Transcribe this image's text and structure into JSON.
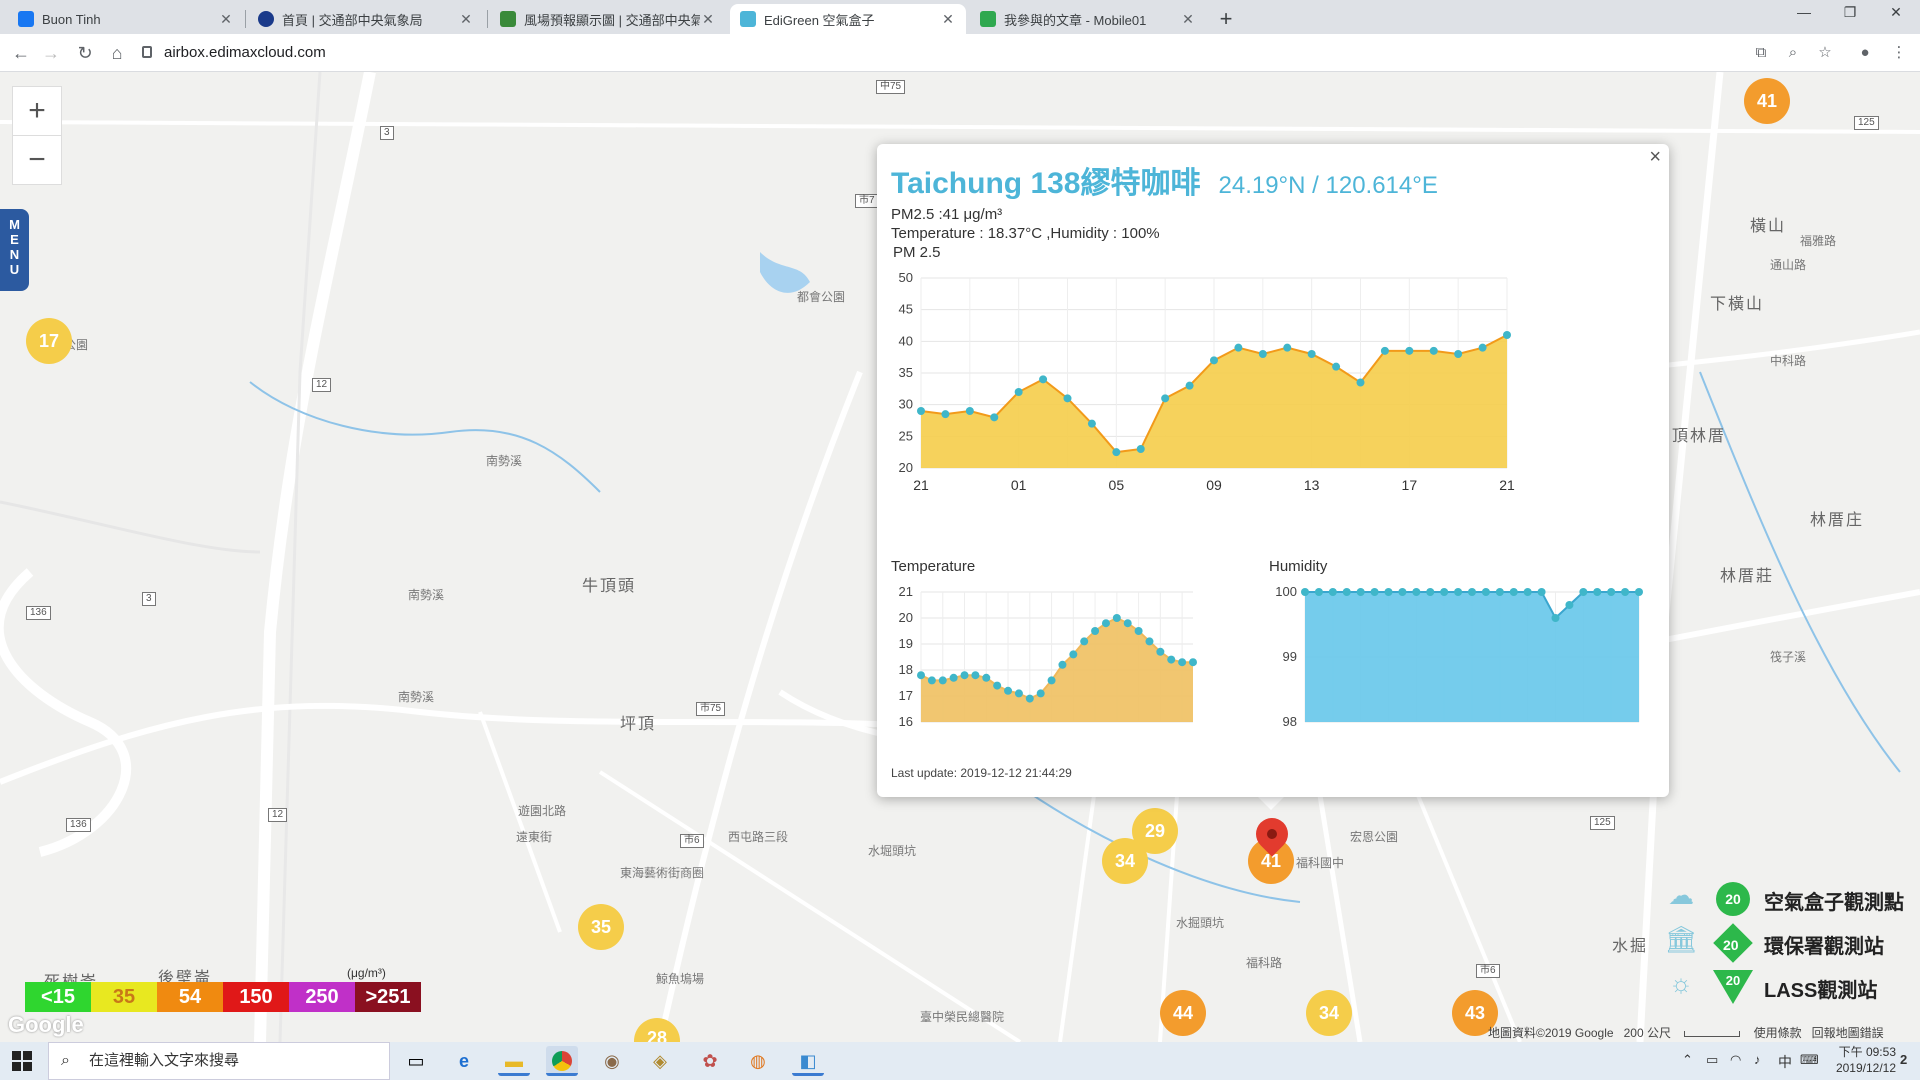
{
  "browser": {
    "tabs": [
      {
        "title": "Buon Tinh",
        "color": "#1877f2"
      },
      {
        "title": "首頁 | 交通部中央氣象局",
        "color": "#1a3a8a"
      },
      {
        "title": "風場預報顯示圖 | 交通部中央氣象局",
        "color": "#3a8a3a"
      },
      {
        "title": "EdiGreen 空氣盒子",
        "color": "#4db5d8"
      },
      {
        "title": "我參與的文章 - Mobile01",
        "color": "#2fa84f"
      }
    ],
    "url": "airbox.edimaxcloud.com",
    "new_tab": "+",
    "win_min": "—",
    "win_max": "❐",
    "win_close": "✕"
  },
  "map": {
    "zoom_in": "+",
    "zoom_out": "−",
    "menu_label": "MENU",
    "markers": [
      {
        "value": "41",
        "level": "o"
      },
      {
        "value": "17",
        "level": "y"
      },
      {
        "value": "29",
        "level": "y"
      },
      {
        "value": "34",
        "level": "y"
      },
      {
        "value": "41",
        "level": "o"
      },
      {
        "value": "35",
        "level": "y"
      },
      {
        "value": "44",
        "level": "o"
      },
      {
        "value": "34",
        "level": "y"
      },
      {
        "value": "43",
        "level": "o"
      },
      {
        "value": "28",
        "level": "y"
      }
    ],
    "place_labels": [
      "牛頂頭",
      "坪頂",
      "都會公園",
      "明秀公園",
      "橫山",
      "下橫山",
      "頂林厝",
      "林厝庄",
      "林厝莊",
      "東海藝術街商圈",
      "宏恩公園",
      "後壁崙",
      "死樹崙",
      "福科國中",
      "水掘",
      "鯨魚塢場",
      "臺中榮民總醫院"
    ],
    "water_labels": [
      "南勢溪",
      "南勢溪",
      "南勢溪",
      "水掘頭坑",
      "水堀頭坑",
      "筏子溪"
    ],
    "road_labels": [
      "福科路",
      "西屯路三段",
      "遊園北路",
      "遠東街",
      "中科路",
      "通山路",
      "福雅路"
    ],
    "road_shields": [
      "中75",
      "市75",
      "市6",
      "市6",
      "市7",
      "125",
      "125",
      "136",
      "136",
      "12",
      "12",
      "3",
      "3"
    ],
    "legend": {
      "unit": "(μg/m³)",
      "levels": [
        {
          "label": "<15",
          "color": "#2fd62f"
        },
        {
          "label": "35",
          "color": "#e8e820"
        },
        {
          "label": "54",
          "color": "#f08a10"
        },
        {
          "label": "150",
          "color": "#e01818"
        },
        {
          "label": "250",
          "color": "#c030c8"
        },
        {
          "label": ">251",
          "color": "#8a1020"
        }
      ]
    },
    "type_legend": [
      {
        "badge": "20",
        "label": "空氣盒子觀測點",
        "shape": "circle",
        "icon": "cloud-box-icon"
      },
      {
        "badge": "20",
        "label": "環保署觀測站",
        "shape": "diamond",
        "icon": "government-building-icon"
      },
      {
        "badge": "20",
        "label": "LASS觀測站",
        "shape": "tri",
        "icon": "sun-wave-icon"
      }
    ],
    "google_logo": "Google",
    "attribution": "地圖資料©2019 Google",
    "scale": "200 公尺",
    "terms": "使用條款",
    "report": "回報地圖錯誤"
  },
  "popup": {
    "close": "×",
    "title": "Taichung 138繆特咖啡",
    "coords": "24.19°N / 120.614°E",
    "pm25_line": "PM2.5 :41 μg/m³",
    "temp_hum_line": "Temperature : 18.37°C ,Humidity : 100%",
    "chart_title": "PM 2.5",
    "last_update": "Last update: 2019-12-12 21:44:29"
  },
  "chart_data": [
    {
      "type": "area",
      "title": "PM 2.5",
      "x": [
        "21",
        "22",
        "23",
        "00",
        "01",
        "02",
        "03",
        "04",
        "05",
        "06",
        "07",
        "08",
        "09",
        "10",
        "11",
        "12",
        "13",
        "14",
        "15",
        "16",
        "17",
        "18",
        "19",
        "20",
        "21"
      ],
      "x_tick_labels": [
        "21",
        "01",
        "05",
        "09",
        "13",
        "17",
        "21"
      ],
      "values": [
        29,
        28.5,
        29,
        28,
        32,
        34,
        31,
        27,
        22.5,
        23,
        31,
        33,
        37,
        39,
        38,
        39,
        38,
        36,
        33.5,
        38.5,
        38.5,
        38.5,
        38,
        39,
        41
      ],
      "ylim": [
        20,
        50
      ],
      "y_ticks": [
        20,
        25,
        30,
        35,
        40,
        45,
        50
      ],
      "grid": true,
      "color": "#f5cd4a"
    },
    {
      "type": "area",
      "title": "Temperature",
      "values": [
        17.8,
        17.6,
        17.6,
        17.7,
        17.8,
        17.8,
        17.7,
        17.4,
        17.2,
        17.1,
        16.9,
        17.1,
        17.6,
        18.2,
        18.6,
        19.1,
        19.5,
        19.8,
        20.0,
        19.8,
        19.5,
        19.1,
        18.7,
        18.4,
        18.3,
        18.3
      ],
      "ylim": [
        16,
        21
      ],
      "y_ticks": [
        16,
        17,
        18,
        19,
        20,
        21
      ],
      "grid": true,
      "color": "#f0c060"
    },
    {
      "type": "area",
      "title": "Humidity",
      "values": [
        100,
        100,
        100,
        100,
        100,
        100,
        100,
        100,
        100,
        100,
        100,
        100,
        100,
        100,
        100,
        100,
        100,
        100,
        99.6,
        99.8,
        100,
        100,
        100,
        100,
        100
      ],
      "ylim": [
        98,
        100
      ],
      "y_ticks": [
        98,
        99,
        100
      ],
      "grid": true,
      "color": "#66c7ea"
    }
  ],
  "taskbar": {
    "search_placeholder": "在這裡輸入文字來搜尋",
    "time": "下午 09:53",
    "date": "2019/12/12",
    "ime": "中",
    "notif": "2"
  }
}
